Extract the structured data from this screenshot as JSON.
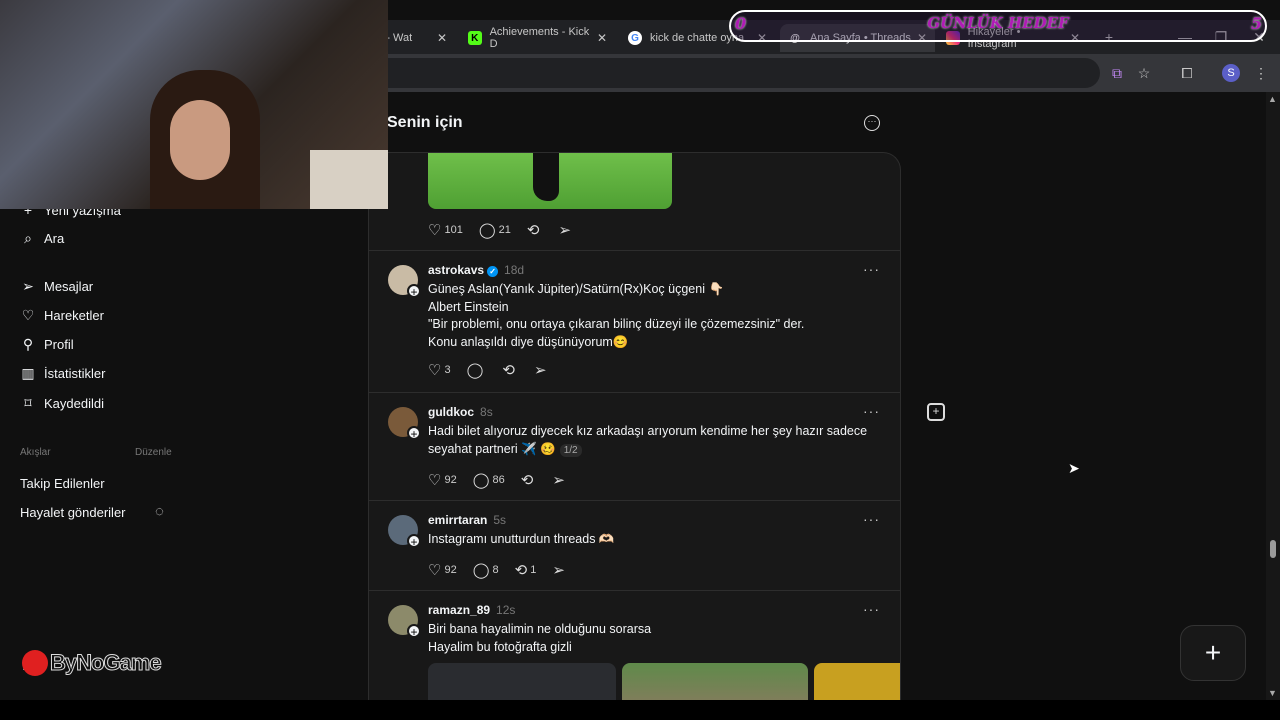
{
  "browser": {
    "tabs": [
      {
        "label": "am - Wat",
        "active": false
      },
      {
        "label": "Achievements - Kick D",
        "active": false
      },
      {
        "label": "kick de chatte oyna",
        "active": false
      },
      {
        "label": "Ana Sayfa • Threads",
        "active": true
      },
      {
        "label": "Hikayeler • Instagram",
        "active": false
      }
    ],
    "profile_initial": "S"
  },
  "overlay": {
    "goal_label": "GÜNLÜK HEDEF",
    "goal_current": "0",
    "goal_target": "5",
    "brand": "ByNoGame"
  },
  "sidebar": {
    "new_post_label": "Yeni yazışma",
    "items": [
      {
        "label": "Ara",
        "icon": "search-icon"
      },
      {
        "label": "Mesajlar",
        "icon": "send-icon"
      },
      {
        "label": "Hareketler",
        "icon": "heart-icon"
      },
      {
        "label": "Profil",
        "icon": "person-icon"
      },
      {
        "label": "İstatistikler",
        "icon": "chart-icon"
      },
      {
        "label": "Kaydedildi",
        "icon": "bookmark-icon"
      }
    ],
    "feeds_header": "Akışlar",
    "feeds_edit": "Düzenle",
    "feeds": [
      {
        "label": "Takip Edilenler"
      },
      {
        "label": "Hayalet gönderiler"
      }
    ]
  },
  "feed": {
    "title": "Senin için",
    "top_post": {
      "likes": "101",
      "comments": "21"
    },
    "posts": [
      {
        "user": "astrokavs",
        "verified": true,
        "time": "18d",
        "lines": [
          "Güneş Aslan(Yanık Jüpiter)/Satürn(Rx)Koç üçgeni 👇🏻",
          "Albert Einstein",
          "\"Bir problemi, onu ortaya çıkaran bilinç düzeyi ile çözemezsiniz\" der.",
          "Konu anlaşıldı diye düşünüyorum😊"
        ],
        "likes": "3",
        "comments": "",
        "reposts": ""
      },
      {
        "user": "guldkoc",
        "verified": false,
        "time": "8s",
        "lines": [
          "Hadi bilet alıyoruz diyecek kız arkadaşı arıyorum kendime her şey hazır sadece",
          "seyahat partneri ✈️ 🥴"
        ],
        "pager": "1/2",
        "likes": "92",
        "comments": "86",
        "reposts": ""
      },
      {
        "user": "emirrtaran",
        "verified": false,
        "time": "5s",
        "lines": [
          "Instagramı unutturdun threads 🫶🏻"
        ],
        "likes": "92",
        "comments": "8",
        "reposts": "1"
      },
      {
        "user": "ramazn_89",
        "verified": false,
        "time": "12s",
        "lines": [
          "Biri bana hayalimin ne olduğunu sorarsa",
          "Hayalim bu fotoğrafta gizli"
        ],
        "likes": "",
        "comments": "",
        "reposts": ""
      }
    ]
  }
}
